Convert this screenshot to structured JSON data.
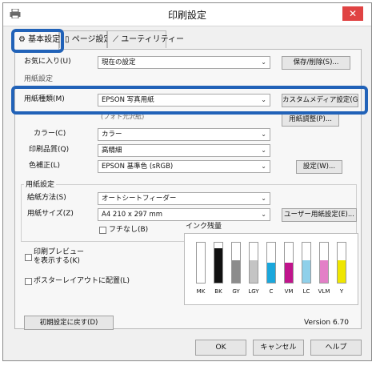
{
  "window": {
    "title": "印刷設定",
    "close_label": "✕"
  },
  "tabs": [
    {
      "label": "基本設定"
    },
    {
      "label": "ページ設定"
    },
    {
      "label": "ユーティリティー"
    }
  ],
  "favorites": {
    "label": "お気に入り(U)",
    "value": "現在の設定",
    "save_button": "保存/削除(S)..."
  },
  "section_media": {
    "title": "用紙設定"
  },
  "media_type": {
    "label": "用紙種類(M)",
    "value": "EPSON 写真用紙",
    "custom_button": "カスタムメディア設定(G)...",
    "sub_value": "(フォト光沢紙)"
  },
  "paper_adjust_button": "用紙調整(P)...",
  "color": {
    "label": "カラー(C)",
    "value": "カラー"
  },
  "print_quality": {
    "label": "印刷品質(Q)",
    "value": "高精細"
  },
  "color_mode": {
    "label": "色補正(L)",
    "value": "EPSON 基準色 (sRGB)",
    "settings_button": "設定(W)..."
  },
  "paper_settings": {
    "title": "用紙設定",
    "source_label": "給紙方法(S)",
    "source_value": "オートシートフィーダー",
    "size_label": "用紙サイズ(Z)",
    "size_value": "A4 210 x 297 mm",
    "user_size_button": "ユーザー用紙設定(E)...",
    "borderless_label": "フチなし(B)"
  },
  "preview_label": "印刷プレビューを表示する(K)",
  "poster_label": "ポスターレイアウトに配置(L)",
  "ink": {
    "title": "インク残量",
    "items": [
      {
        "name": "MK",
        "color": "#2b2b2b",
        "level": 0
      },
      {
        "name": "BK",
        "color": "#111111",
        "level": 0.85
      },
      {
        "name": "GY",
        "color": "#8c8c8c",
        "level": 0.55
      },
      {
        "name": "LGY",
        "color": "#c4c4c4",
        "level": 0.55
      },
      {
        "name": "C",
        "color": "#1aa7dc",
        "level": 0.5
      },
      {
        "name": "VM",
        "color": "#c0148c",
        "level": 0.5
      },
      {
        "name": "LC",
        "color": "#8fd0ea",
        "level": 0.55
      },
      {
        "name": "VLM",
        "color": "#e37fc7",
        "level": 0.55
      },
      {
        "name": "Y",
        "color": "#efe600",
        "level": 0.55
      }
    ]
  },
  "restore_defaults_button": "初期設定に戻す(D)",
  "version": "Version 6.70",
  "buttons": {
    "ok": "OK",
    "cancel": "キャンセル",
    "help": "ヘルプ"
  },
  "highlight_color": "#2162b8"
}
